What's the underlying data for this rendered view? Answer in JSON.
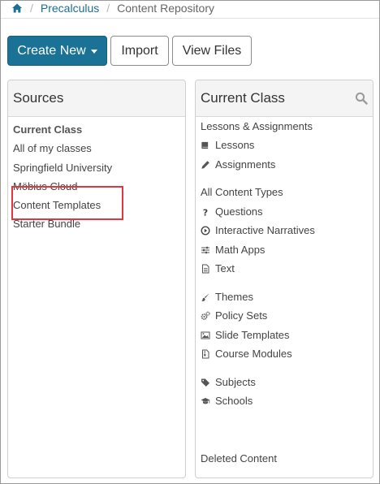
{
  "breadcrumb": {
    "home_icon": "home-icon",
    "separator": "/",
    "items": [
      "Precalculus",
      "Content Repository"
    ]
  },
  "toolbar": {
    "create_new": "Create New",
    "import": "Import",
    "view_files": "View Files"
  },
  "sources": {
    "title": "Sources",
    "items": [
      "Current Class",
      "All of my classes",
      "Springfield University",
      "Möbius Cloud",
      "Content Templates",
      "Starter Bundle"
    ],
    "highlighted": "Content Templates"
  },
  "current_class": {
    "title": "Current Class",
    "search_icon": "search-icon",
    "lessons_assignments": "Lessons & Assignments",
    "lessons": "Lessons",
    "assignments": "Assignments",
    "all_content_types": "All Content Types",
    "questions": "Questions",
    "interactive_narratives": "Interactive Narratives",
    "math_apps": "Math Apps",
    "text": "Text",
    "themes": "Themes",
    "policy_sets": "Policy Sets",
    "slide_templates": "Slide Templates",
    "course_modules": "Course Modules",
    "subjects": "Subjects",
    "schools": "Schools",
    "deleted_content": "Deleted Content"
  },
  "colors": {
    "primary": "#1a7396",
    "link": "#1c6e94",
    "highlight": "#e0373f"
  }
}
